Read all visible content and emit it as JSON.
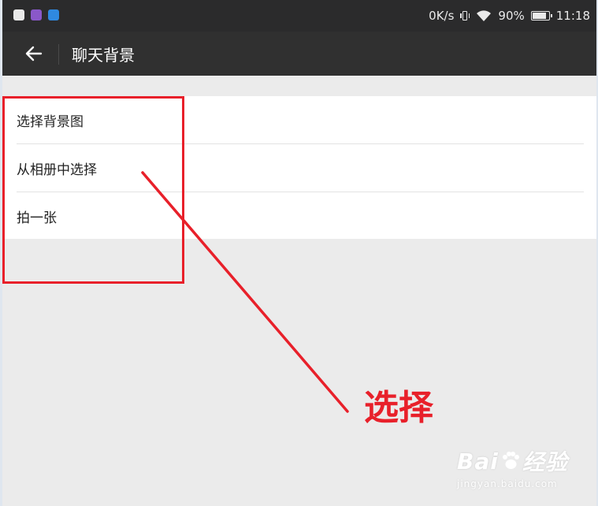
{
  "status_bar": {
    "app_icons": [
      {
        "name": "qq-icon",
        "color": "#e9e9e9"
      },
      {
        "name": "gallery-icon",
        "color": "#8a58c9"
      },
      {
        "name": "app-icon",
        "color": "#2f89e0"
      }
    ],
    "net_speed": "0K/s",
    "battery_percent": "90%",
    "battery_level": 0.9,
    "time": "11:18"
  },
  "top_bar": {
    "back_icon": "arrow-left-icon",
    "title": "聊天背景"
  },
  "menu": {
    "items": [
      {
        "label": "选择背景图"
      },
      {
        "label": "从相册中选择"
      },
      {
        "label": "拍一张"
      }
    ]
  },
  "annotation": {
    "label": "选择",
    "color": "#e8202a"
  },
  "watermark": {
    "brand": "Bai",
    "brand_suffix": "经验",
    "url": "jingyan.baidu.com"
  }
}
